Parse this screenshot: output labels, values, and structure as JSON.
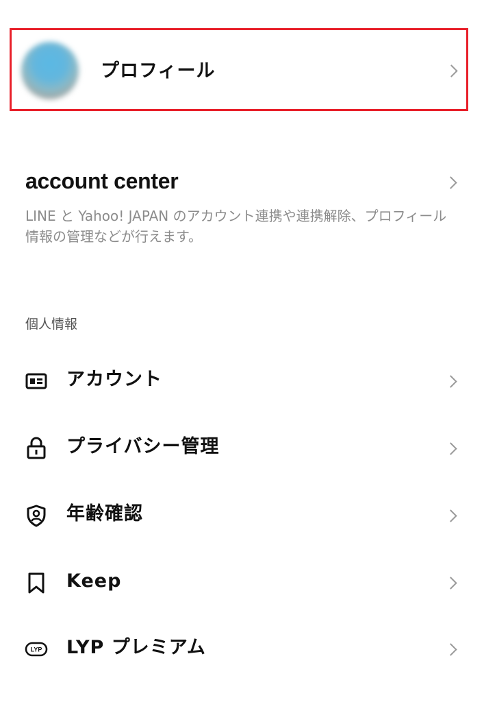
{
  "profile": {
    "label": "プロフィール"
  },
  "account_center": {
    "title": "account center",
    "description": "LINE と Yahoo! JAPAN のアカウント連携や連携解除、プロフィール情報の管理などが行えます。"
  },
  "personal_info": {
    "header": "個人情報",
    "items": [
      {
        "label": "アカウント",
        "icon": "id-card-icon"
      },
      {
        "label": "プライバシー管理",
        "icon": "lock-icon"
      },
      {
        "label": "年齢確認",
        "icon": "shield-person-icon"
      },
      {
        "label": "Keep",
        "icon": "bookmark-icon"
      },
      {
        "label": "LYP プレミアム",
        "icon": "lyp-badge-icon",
        "badge_text": "LYP"
      }
    ]
  },
  "colors": {
    "highlight_border": "#e8202a",
    "chevron": "#9a9a9a",
    "secondary_text": "#8c8c8c"
  }
}
